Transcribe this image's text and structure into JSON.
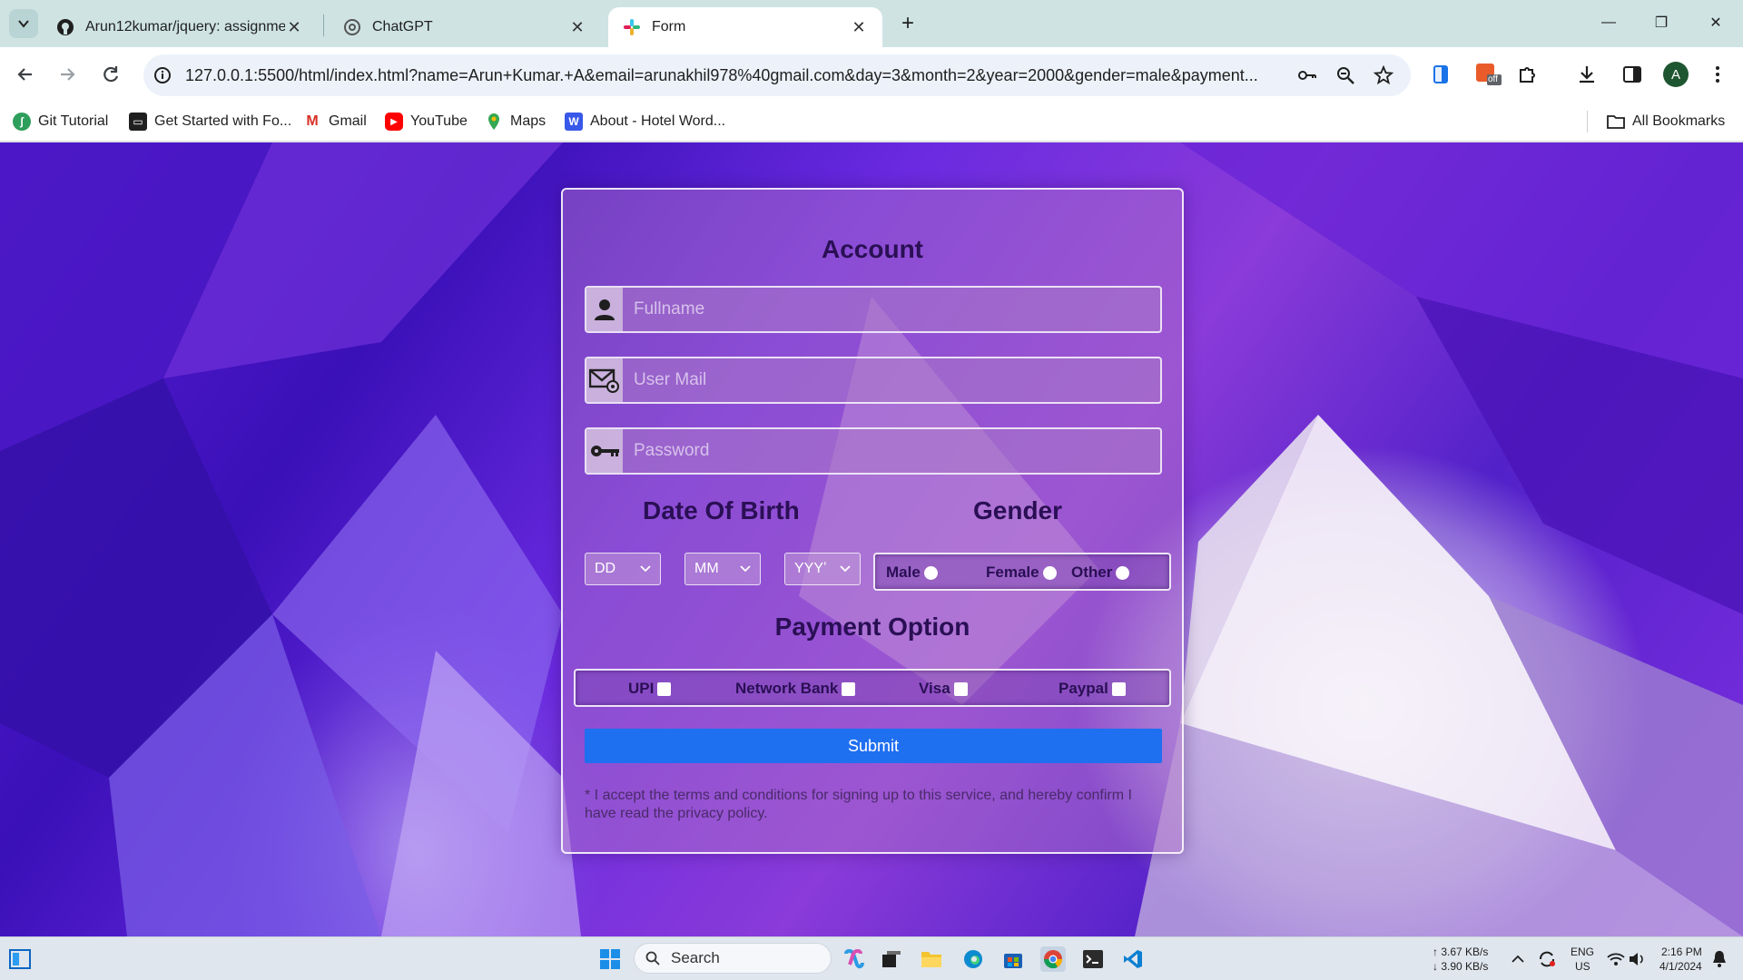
{
  "browser": {
    "tabs": [
      {
        "title": "Arun12kumar/jquery: assignme",
        "icon": "github-icon",
        "active": false
      },
      {
        "title": "ChatGPT",
        "icon": "chatgpt-icon",
        "active": false
      },
      {
        "title": "Form",
        "icon": "form-favicon-icon",
        "active": true
      }
    ],
    "url": "127.0.0.1:5500/html/index.html?name=Arun+Kumar.+A&email=arunakhil978%40gmail.com&day=3&month=2&year=2000&gender=male&payment...",
    "bookmarks": [
      {
        "label": "Git Tutorial",
        "icon": "git-icon"
      },
      {
        "label": "Get Started with Fo...",
        "icon": "folder-page-icon"
      },
      {
        "label": "Gmail",
        "icon": "gmail-icon"
      },
      {
        "label": "YouTube",
        "icon": "youtube-icon"
      },
      {
        "label": "Maps",
        "icon": "maps-icon"
      },
      {
        "label": "About - Hotel Word...",
        "icon": "wordpress-icon"
      }
    ],
    "all_bookmarks": "All Bookmarks",
    "profile_initial": "A",
    "extension_badge": "off"
  },
  "form": {
    "title": "Account",
    "fullname_placeholder": "Fullname",
    "email_placeholder": "User Mail",
    "password_placeholder": "Password",
    "dob_title": "Date Of Birth",
    "gender_title": "Gender",
    "day_select": "DD",
    "month_select": "MM",
    "year_select": "YYYʼ",
    "gender_options": [
      "Male",
      "Female",
      "Other"
    ],
    "payment_title": "Payment Option",
    "payment_options": [
      "UPI",
      "Network Bank",
      "Visa",
      "Paypal"
    ],
    "submit_label": "Submit",
    "terms": "* I accept the terms and conditions for signing up to this service, and hereby confirm I have read the privacy policy."
  },
  "taskbar": {
    "search_label": "Search",
    "net_up": "↑ 3.67 KB/s",
    "net_down": "↓ 3.90 KB/s",
    "lang": "ENG",
    "region": "US",
    "time": "2:16 PM",
    "date": "4/1/2024"
  }
}
